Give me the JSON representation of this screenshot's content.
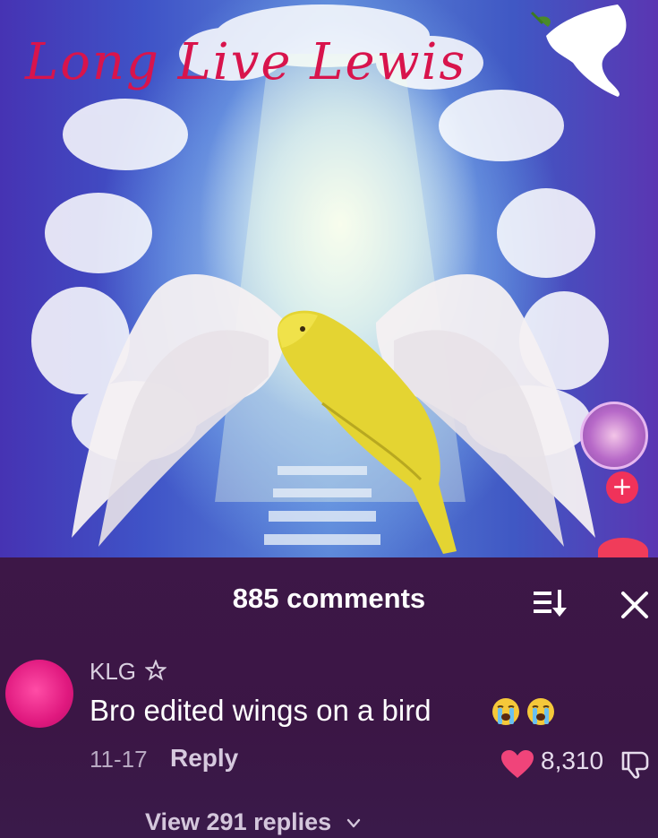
{
  "video": {
    "title_overlay": "Long Live Lewis"
  },
  "sidebar": {
    "follow_label": "+"
  },
  "comments": {
    "count_label": "885 comments",
    "items": [
      {
        "username": "KLG",
        "text": "Bro edited wings on a bird",
        "date": "11-17",
        "reply_label": "Reply",
        "likes": "8,310",
        "replies_label": "View 291 replies"
      }
    ]
  },
  "colors": {
    "sheet_bg": "#3d1747",
    "like_heart": "#f0447a",
    "title_red": "#d8144c",
    "accent_pink": "#f0325a"
  },
  "icons": [
    "dove-icon",
    "sort-icon",
    "close-icon",
    "star-icon",
    "crying-emoji-icon",
    "heart-icon",
    "dislike-icon",
    "chevron-down-icon"
  ]
}
